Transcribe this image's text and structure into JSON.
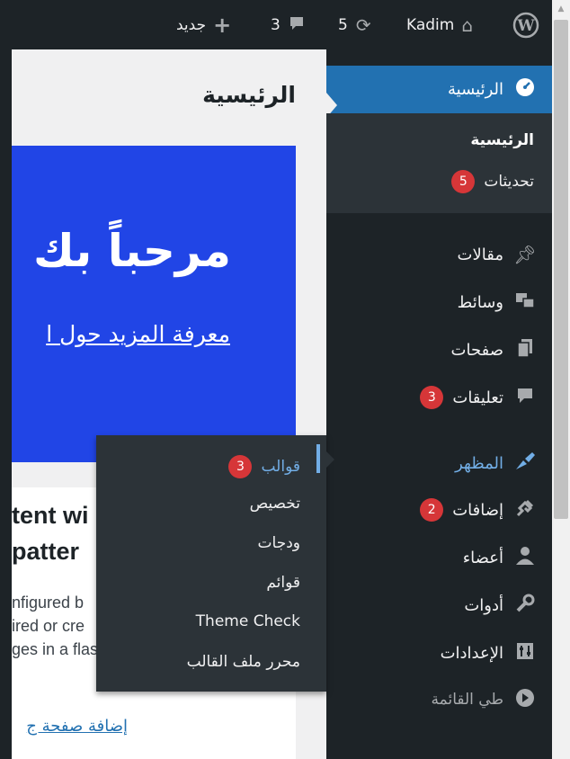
{
  "admin_bar": {
    "user": "Kadim",
    "updates_count": "5",
    "comments_count": "3",
    "new_label": "جديد",
    "icons": {
      "wp": "wordpress-icon",
      "home": "home-icon",
      "updates": "refresh-icon",
      "comments": "comment-icon",
      "new": "plus-icon"
    }
  },
  "content": {
    "page_title": "الرئيسية",
    "welcome_title": "مرحباً بك",
    "welcome_link": "معرفة المزيد حول ا",
    "card_heading_line1": "tent wi",
    "card_heading_line2": "patter",
    "card_text_line1": "nfigured b",
    "card_text_line2": "ired or cre",
    "card_text_line3": "ges in a flash",
    "card_link": "إضافة صفحة ج"
  },
  "sidebar": {
    "dashboard": {
      "label": "الرئيسية",
      "icon": "dashboard-icon"
    },
    "dashboard_sub": [
      {
        "label": "الرئيسية"
      },
      {
        "label": "تحديثات",
        "badge": "5"
      }
    ],
    "items": [
      {
        "label": "مقالات",
        "icon": "pin-icon"
      },
      {
        "label": "وسائط",
        "icon": "media-icon"
      },
      {
        "label": "صفحات",
        "icon": "pages-icon"
      },
      {
        "label": "تعليقات",
        "icon": "comments-icon",
        "badge": "3"
      },
      {
        "label": "المظهر",
        "icon": "appearance-icon"
      },
      {
        "label": "إضافات",
        "icon": "plugins-icon",
        "badge": "2"
      },
      {
        "label": "أعضاء",
        "icon": "users-icon"
      },
      {
        "label": "أدوات",
        "icon": "tools-icon"
      },
      {
        "label": "الإعدادات",
        "icon": "settings-icon"
      }
    ],
    "collapse_label": "طي القائمة"
  },
  "flyout": {
    "items": [
      {
        "label": "قوالب",
        "badge": "3"
      },
      {
        "label": "تخصيص"
      },
      {
        "label": "ودجات"
      },
      {
        "label": "قوائم"
      },
      {
        "label": "Theme Check"
      },
      {
        "label": "محرر ملف القالب"
      }
    ]
  },
  "colors": {
    "admin_bg": "#1d2327",
    "active_blue": "#2271b1",
    "highlight_blue": "#72aee6",
    "badge_red": "#d63638",
    "welcome_blue": "#2145e6"
  }
}
